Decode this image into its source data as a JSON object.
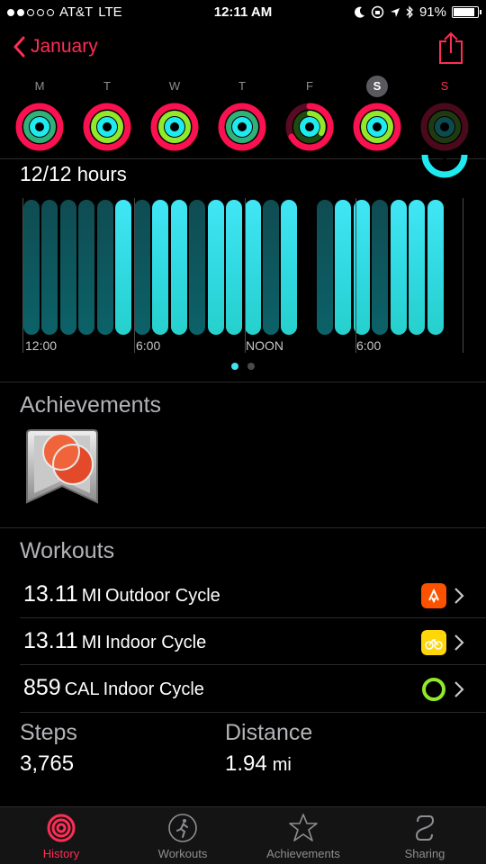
{
  "status": {
    "carrier": "AT&T",
    "network": "LTE",
    "time": "12:11 AM",
    "battery": "91%"
  },
  "nav": {
    "back_label": "January"
  },
  "week": [
    {
      "letter": "M"
    },
    {
      "letter": "T"
    },
    {
      "letter": "W"
    },
    {
      "letter": "T"
    },
    {
      "letter": "F"
    },
    {
      "letter": "S"
    },
    {
      "letter": "S"
    }
  ],
  "stand": {
    "value": "12/12",
    "unit": "hours",
    "x_labels": [
      "12:00",
      "6:00",
      "NOON",
      "6:00"
    ]
  },
  "achievements": {
    "title": "Achievements"
  },
  "workouts": {
    "title": "Workouts",
    "items": [
      {
        "value": "13.11",
        "unit": "MI",
        "name": "Outdoor Cycle"
      },
      {
        "value": "13.11",
        "unit": "MI",
        "name": "Indoor Cycle"
      },
      {
        "value": "859",
        "unit": "CAL",
        "name": "Indoor Cycle"
      }
    ]
  },
  "stats": {
    "steps_label": "Steps",
    "steps_value": "3,765",
    "distance_label": "Distance",
    "distance_value": "1.94",
    "distance_unit": "mi"
  },
  "tabs": [
    {
      "label": "History"
    },
    {
      "label": "Workouts"
    },
    {
      "label": "Achievements"
    },
    {
      "label": "Sharing"
    }
  ],
  "colors": {
    "accent": "#ff2d55",
    "move": "#fa114f",
    "exercise": "#92e82a",
    "stand": "#1eeaef"
  }
}
